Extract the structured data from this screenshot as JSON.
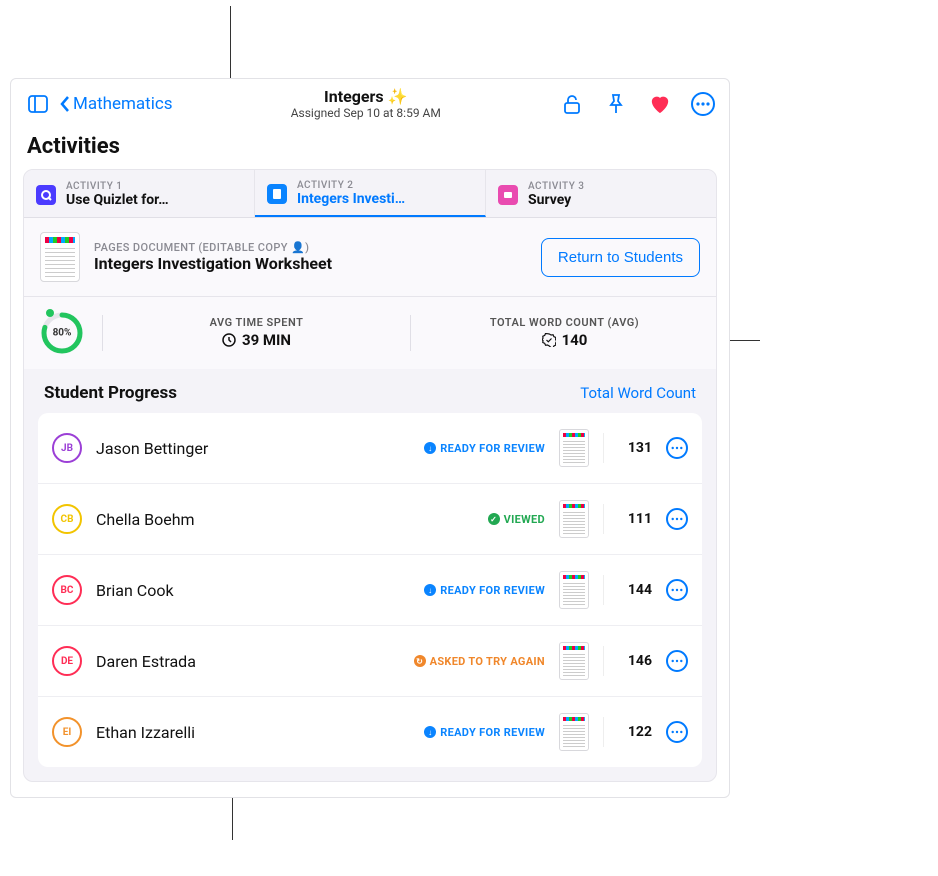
{
  "header": {
    "back_label": "Mathematics",
    "title": "Integers ✨",
    "assigned_text": "Assigned Sep 10 at 8:59 AM"
  },
  "section_title": "Activities",
  "tabs": [
    {
      "overline": "ACTIVITY 1",
      "label": "Use Quizlet for…",
      "icon": "quizlet",
      "color": "purple",
      "active": false
    },
    {
      "overline": "ACTIVITY 2",
      "label": "Integers Investi…",
      "icon": "document",
      "color": "blue",
      "active": true
    },
    {
      "overline": "ACTIVITY 3",
      "label": "Survey",
      "icon": "survey",
      "color": "pink",
      "active": false
    }
  ],
  "document": {
    "type_label": "PAGES DOCUMENT (EDITABLE COPY",
    "title": "Integers Investigation Worksheet",
    "return_button": "Return to Students"
  },
  "stats": {
    "progress_pct": "80%",
    "avg_time_label": "AVG TIME SPENT",
    "avg_time_value": "39 MIN",
    "word_count_label": "TOTAL WORD COUNT (AVG)",
    "word_count_value": "140"
  },
  "progress_header": {
    "title": "Student Progress",
    "link": "Total Word Count"
  },
  "status_labels": {
    "ready_for_review": "READY FOR REVIEW",
    "viewed": "VIEWED",
    "asked_to_try_again": "ASKED TO TRY AGAIN"
  },
  "students": [
    {
      "initials": "JB",
      "name": "Jason Bettinger",
      "status": "ready_for_review",
      "value": "131",
      "ring_color": "#9b3fd6"
    },
    {
      "initials": "CB",
      "name": "Chella Boehm",
      "status": "viewed",
      "value": "111",
      "ring_color": "#f2c400"
    },
    {
      "initials": "BC",
      "name": "Brian Cook",
      "status": "ready_for_review",
      "value": "144",
      "ring_color": "#ff2d55"
    },
    {
      "initials": "DE",
      "name": "Daren Estrada",
      "status": "asked_to_try_again",
      "value": "146",
      "ring_color": "#ff2d55"
    },
    {
      "initials": "EI",
      "name": "Ethan Izzarelli",
      "status": "ready_for_review",
      "value": "122",
      "ring_color": "#f2922b"
    }
  ]
}
